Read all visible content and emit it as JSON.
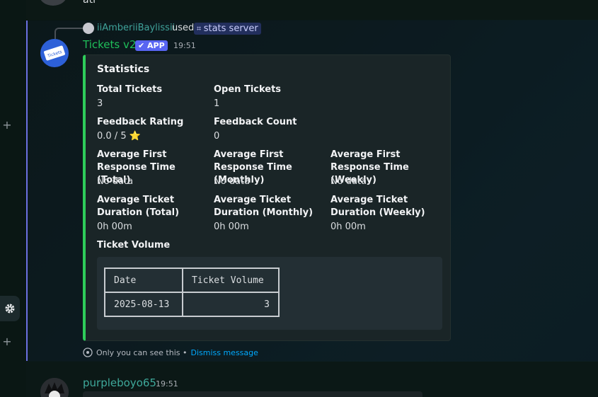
{
  "top_message": {
    "text_fragment": "ati"
  },
  "reply": {
    "username": "iiAmberiiBaylissii",
    "used_label": "used",
    "command": "stats server"
  },
  "bot": {
    "name": "Tickets v2",
    "badge": "APP",
    "time": "19:51",
    "avatar_text": "Tickets"
  },
  "embed": {
    "accent_color": "#2ecc5a",
    "title": "Statistics",
    "fields": [
      {
        "name": "Total Tickets",
        "value": "3"
      },
      {
        "name": "Open Tickets",
        "value": "1"
      },
      {
        "name": "Feedback Rating",
        "value": "0.0 / 5 ⭐"
      },
      {
        "name": "Feedback Count",
        "value": "0"
      },
      {
        "name": "Average First Response Time (Total)",
        "value": "No data"
      },
      {
        "name": "Average First Response Time (Monthly)",
        "value": "No data"
      },
      {
        "name": "Average First Response Time (Weekly)",
        "value": "No data"
      },
      {
        "name": "Average Ticket Duration (Total)",
        "value": "0h 00m"
      },
      {
        "name": "Average Ticket Duration (Monthly)",
        "value": "0h 00m"
      },
      {
        "name": "Average Ticket Duration (Weekly)",
        "value": "0h 00m"
      },
      {
        "name": "Ticket Volume",
        "value": ""
      }
    ],
    "table": {
      "headers": [
        "Date",
        "Ticket Volume"
      ],
      "rows": [
        [
          "2025-08-13",
          "3"
        ]
      ]
    }
  },
  "ephemeral": {
    "text": "Only you can see this •",
    "dismiss": "Dismiss message"
  },
  "next_message": {
    "username": "purpleboyo65",
    "time": "19:51"
  },
  "sidebar": {
    "icons": [
      "plus-icon",
      "gear-icon",
      "plus-icon"
    ]
  }
}
